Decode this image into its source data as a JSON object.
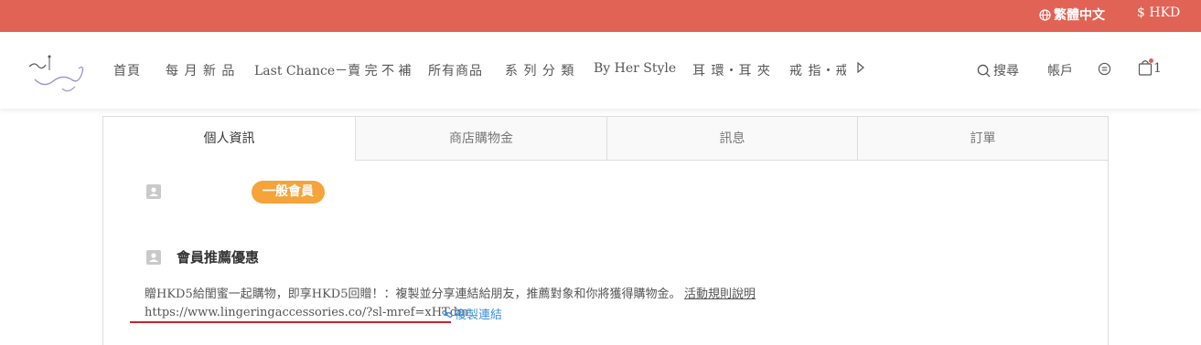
{
  "topbar": {
    "language": "繁體中文",
    "currency": "$ HKD",
    "background_color": "#E06355"
  },
  "header": {
    "logo_icon": "lingering-logo",
    "nav_items": [
      "首頁",
      "每 月 新 品",
      "Last Chance－賣 完 不 補",
      "所有商品",
      "系 列 分 類",
      "By Her Style",
      "耳 環・耳 夾",
      "戒 指・戒"
    ],
    "search_label": "搜尋",
    "account_label": "帳戶",
    "cart_count": "1"
  },
  "member": {
    "tabs": [
      "個人資訊",
      "商店購物金",
      "訊息",
      "訂單"
    ],
    "active_tab": 0,
    "tier_badge": "一般會員",
    "badge_color": "#F5A33B",
    "referral_title": "會員推薦優惠",
    "referral_desc": "贈HKD5給閨蜜一起購物，即享HKD5回贈！：複製並分享連結給朋友，推薦對象和你將獲得購物金。",
    "rules_link": "活動規則說明",
    "referral_url": "https://www.lingeringaccessories.co/?sl-mref=xHTdm",
    "copy_link": "複製連結",
    "link_color": "#3d8fd8"
  }
}
